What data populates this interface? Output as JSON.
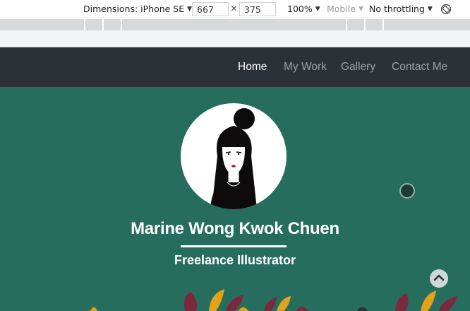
{
  "devtools": {
    "dimensions_label": "Dimensions: iPhone SE",
    "width_value": "667",
    "height_value": "375",
    "times": "×",
    "zoom": "100%",
    "mobile": "Mobile",
    "throttling": "No throttling"
  },
  "nav": {
    "items": [
      {
        "label": "Home",
        "active": true
      },
      {
        "label": "My Work",
        "active": false
      },
      {
        "label": "Gallery",
        "active": false
      },
      {
        "label": "Contact Me",
        "active": false
      }
    ]
  },
  "hero": {
    "name": "Marine Wong Kwok Chuen",
    "subtitle": "Freelance Illustrator"
  },
  "colors": {
    "navbar": "#2c3137",
    "hero": "#266d5d",
    "nav_active": "#ffffff",
    "nav_inactive": "#9aa1a8"
  }
}
